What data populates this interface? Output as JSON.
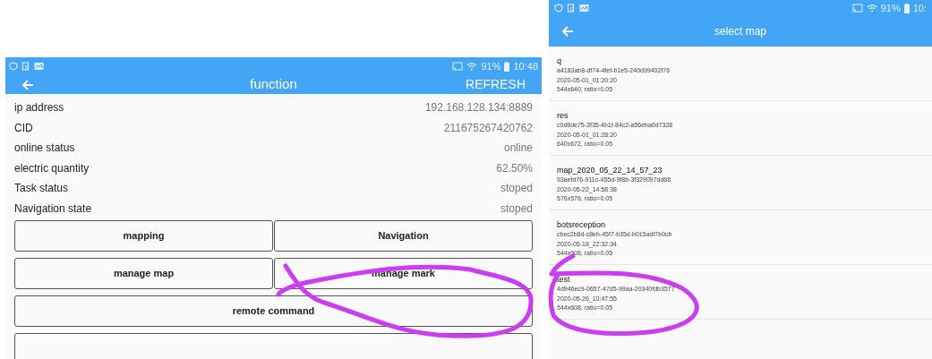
{
  "function_screen": {
    "status_bar": {
      "battery": "91%",
      "time": "10:48"
    },
    "toolbar": {
      "title": "function",
      "action": "REFRESH"
    },
    "info_rows": [
      {
        "label": "ip address",
        "value": "192.168.128.134:8889"
      },
      {
        "label": "CID",
        "value": "211675267420762"
      },
      {
        "label": "online status",
        "value": "online"
      },
      {
        "label": "electric quantity",
        "value": "62.50%"
      },
      {
        "label": "Task status",
        "value": "stoped"
      },
      {
        "label": "Navigation state",
        "value": "stoped"
      }
    ],
    "buttons": [
      {
        "label": "mapping",
        "kind": "half"
      },
      {
        "label": "Navigation",
        "kind": "half"
      },
      {
        "label": "manage map",
        "kind": "half"
      },
      {
        "label": "manage mark",
        "kind": "half"
      },
      {
        "label": "remote command",
        "kind": "full"
      }
    ]
  },
  "select_map_screen": {
    "status_bar": {
      "battery": "91%",
      "time": "10:"
    },
    "toolbar": {
      "title": "select map"
    },
    "maps": [
      {
        "name": "q",
        "id": "a4183ab8-df74-4fef-b1e5-240d99402f76",
        "date": "2020-05-01_01:20:20",
        "size": "544x640, ratio=0.05"
      },
      {
        "name": "res",
        "id": "c0d8de75-3f35-4b1f-84c2-a56eba0d7328",
        "date": "2020-05-01_01:28:20",
        "size": "640x672, ratio=0.05"
      },
      {
        "name": "map_2020_05_22_14_57_23",
        "id": "93aefd76-911c-455d-9f8b-3f329097dd68",
        "date": "2020-05-22_14:58:38",
        "size": "576x576, ratio=0.05"
      },
      {
        "name": "botsreception",
        "id": "cbec2b8d-c8eb-45f7-b35d-b015adf7b0cb",
        "date": "2020-05-18_22:32:34",
        "size": "544x608, ratio=0.05"
      },
      {
        "name": "test",
        "id": "4d946ec9-0657-47d5-99aa-20340fdb3577",
        "date": "2020-05-26_10:47:55",
        "size": "544x608, ratio=0.05"
      }
    ]
  }
}
